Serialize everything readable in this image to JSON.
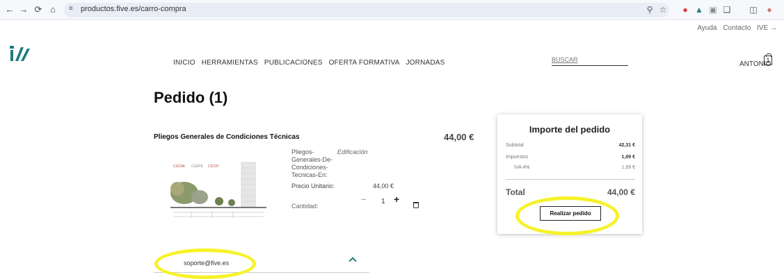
{
  "browser": {
    "url": "productos.five.es/carro-compra"
  },
  "utility_links": [
    "Ayuda",
    "Contacto",
    "IVE →"
  ],
  "nav": {
    "items": [
      "INICIO",
      "HERRAMIENTAS",
      "PUBLICACIONES",
      "OFERTA FORMATIVA",
      "JORNADAS"
    ],
    "search_label": "BUSCAR",
    "user_name": "ANTONIO",
    "cart_count": "1"
  },
  "page": {
    "title": "Pedido (1)"
  },
  "product": {
    "name": "Pliegos Generales de Condiciones Técnicas",
    "line_total": "44,00 €",
    "code": "Pliegos-Generales-De-Condiciones-Tecnicas-En:",
    "category": "Edificación",
    "unit_price_label": "Precio Unitario:",
    "unit_price": "44,00 €",
    "quantity_label": "Cantidad:",
    "quantity": "1",
    "minus": "−",
    "plus": "+",
    "image_logos": [
      "CSCAE",
      "CGATE",
      "CICCP"
    ]
  },
  "summary": {
    "title": "Importe del pedido",
    "subtotal_label": "Subtotal",
    "subtotal": "42,31 €",
    "taxes_label": "Impuestos",
    "taxes": "1,69 €",
    "iva_label": "IVA 4%",
    "iva": "1,69 €",
    "total_label": "Total",
    "total": "44,00 €",
    "order_button": "Realizar pedido"
  },
  "support": {
    "email": "soporte@five.es"
  },
  "colors": {
    "brand_teal": "#1e7b82",
    "highlight_yellow": "#f7f228"
  }
}
